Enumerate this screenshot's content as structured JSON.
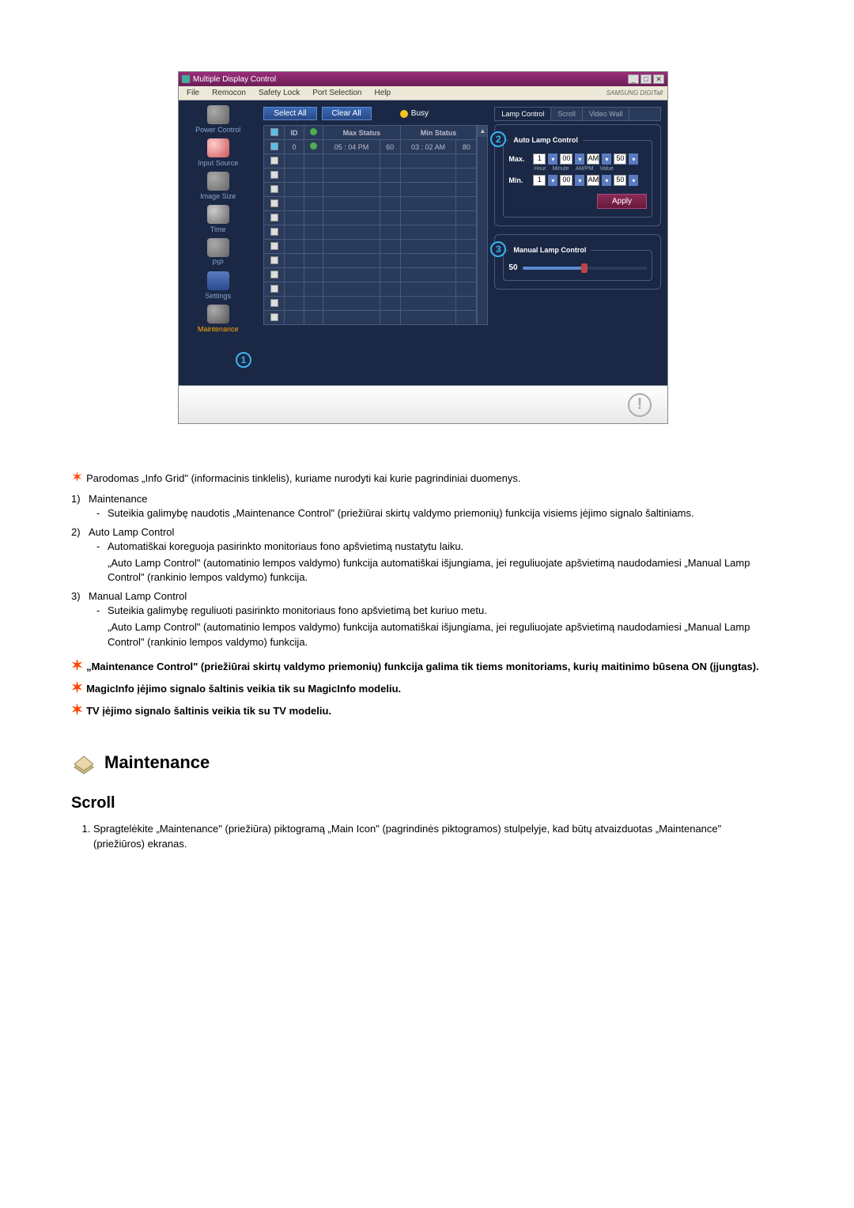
{
  "window": {
    "title": "Multiple Display Control",
    "brand": "SAMSUNG DIGITall"
  },
  "menu": [
    "File",
    "Remocon",
    "Safety Lock",
    "Port Selection",
    "Help"
  ],
  "sidebar": {
    "items": [
      {
        "label": "Power Control"
      },
      {
        "label": "Input Source"
      },
      {
        "label": "Image Size"
      },
      {
        "label": "Time"
      },
      {
        "label": "PIP"
      },
      {
        "label": "Settings"
      },
      {
        "label": "Maintenance"
      }
    ],
    "annot1": "1"
  },
  "center": {
    "select_all": "Select All",
    "clear_all": "Clear All",
    "busy": "Busy",
    "cols": {
      "id": "ID",
      "max": "Max Status",
      "min": "Min Status"
    },
    "row0": {
      "id": "0",
      "max_time": "05 : 04 PM",
      "max_val": "60",
      "min_time": "03 : 02 AM",
      "min_val": "80"
    }
  },
  "rpanel": {
    "tabs": [
      "Lamp Control",
      "Scroll",
      "Video Wall"
    ],
    "auto_title": "Auto Lamp Control",
    "max_lbl": "Max.",
    "min_lbl": "Min.",
    "hh": "1",
    "mm": "00",
    "ampm": "AM",
    "val": "50",
    "sublabs": {
      "hour": "Hour",
      "minute": "Minute",
      "ampm": "AM/PM",
      "value": "Value"
    },
    "apply": "Apply",
    "manual_title": "Manual Lamp Control",
    "slider_val": "50",
    "annot2": "2",
    "annot3": "3"
  },
  "notes": {
    "star1": "Parodomas „Info Grid\" (informacinis tinklelis), kuriame nurodyti kai kurie pagrindiniai duomenys.",
    "n1": {
      "num": "1)",
      "title": "Maintenance",
      "body": "Suteikia galimybę naudotis „Maintenance Control\" (priežiūrai skirtų valdymo priemonių) funkcija visiems įėjimo signalo šaltiniams."
    },
    "n2": {
      "num": "2)",
      "title": "Auto Lamp Control",
      "l1": "Automatiškai koreguoja pasirinkto monitoriaus fono apšvietimą nustatytu laiku.",
      "l2": "„Auto Lamp Control\" (automatinio lempos valdymo) funkcija automatiškai išjungiama, jei reguliuojate apšvietimą naudodamiesi „Manual Lamp Control\" (rankinio lempos valdymo) funkcija."
    },
    "n3": {
      "num": "3)",
      "title": "Manual Lamp Control",
      "l1": "Suteikia galimybę reguliuoti pasirinkto monitoriaus fono apšvietimą bet kuriuo metu.",
      "l2": "„Auto Lamp Control\" (automatinio lempos valdymo) funkcija automatiškai išjungiama, jei reguliuojate apšvietimą naudodamiesi „Manual Lamp Control\" (rankinio lempos valdymo) funkcija."
    },
    "b1": "„Maintenance Control\" (priežiūrai skirtų valdymo priemonių) funkcija galima tik tiems monitoriams, kurių maitinimo būsena ON (įjungtas).",
    "b2": "MagicInfo įėjimo signalo šaltinis veikia tik su MagicInfo modeliu.",
    "b3": "TV įėjimo signalo šaltinis veikia tik su TV modeliu."
  },
  "maint_section": {
    "title": "Maintenance"
  },
  "scroll_section": {
    "title": "Scroll",
    "item1": "Spragtelėkite „Maintenance\" (priežiūra) piktogramą „Main Icon\" (pagrindinės piktogramos) stulpelyje, kad būtų atvaizduotas „Maintenance\" (priežiūros) ekranas."
  }
}
